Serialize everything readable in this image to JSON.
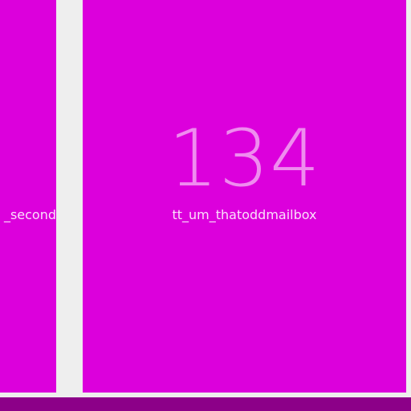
{
  "cards": [
    {
      "count": "",
      "label": "_second"
    },
    {
      "count": "134",
      "label": "tt_um_thatoddmailbox"
    }
  ],
  "colors": {
    "card": "#dc00dc",
    "background": "#eeeeee",
    "bottom_bar": "#8c0088"
  }
}
